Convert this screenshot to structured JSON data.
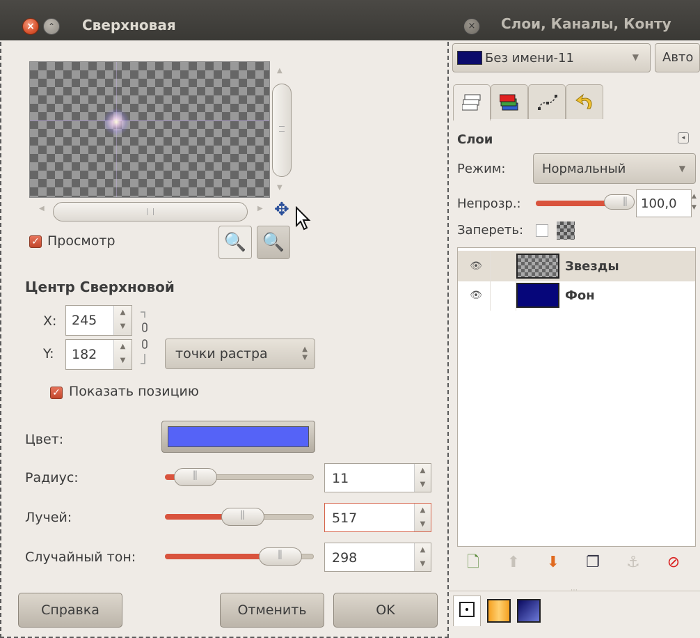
{
  "dialog": {
    "title": "Сверхновая",
    "preview_label": "Просмотр",
    "center_title": "Центр Сверхновой",
    "x_label": "X:",
    "x_value": "245",
    "y_label": "Y:",
    "y_value": "182",
    "unit": "точки растра",
    "show_position_label": "Показать позицию",
    "color_label": "Цвет:",
    "color_value": "#5563f7",
    "radius_label": "Радиус:",
    "radius_value": "11",
    "spokes_label": "Лучей:",
    "spokes_value": "517",
    "random_hue_label": "Случайный тон:",
    "random_hue_value": "298",
    "help_button": "Справка",
    "cancel_button": "Отменить",
    "ok_button": "OK"
  },
  "panel": {
    "title": "Слои, Каналы, Конту",
    "image_select": "Без имени-11",
    "auto_button": "Авто",
    "layers_heading": "Слои",
    "mode_label": "Режим:",
    "mode_value": "Нормальный",
    "opacity_label": "Непрозр.:",
    "opacity_value": "100,0",
    "lock_label": "Запереть:",
    "layers": [
      {
        "name": "Звезды"
      },
      {
        "name": "Фон"
      }
    ]
  },
  "icons": {
    "window_close": "close-icon",
    "window_minimize": "minimize-icon",
    "navigate": "move-cross-icon",
    "zoom_out": "zoom-out-icon",
    "zoom_in": "zoom-in-icon",
    "chain": "chain-link-icon",
    "layer_visibility": "eye-icon"
  },
  "colors": {
    "accent": "#d9533d",
    "title_bar": "#3f3d39",
    "flare_color": "#5563f7",
    "background_layer": "#06067a"
  }
}
